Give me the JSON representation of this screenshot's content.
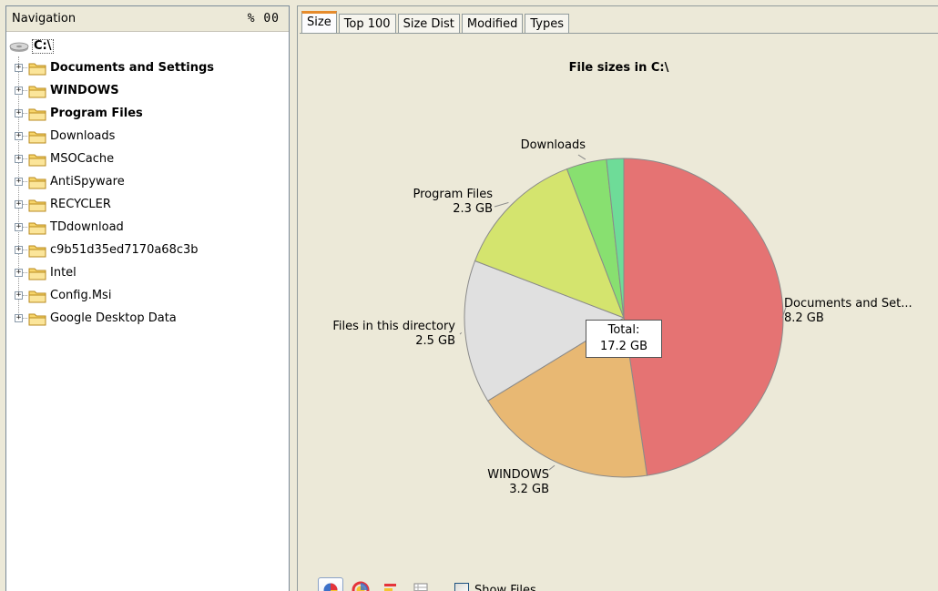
{
  "navigation": {
    "title": "Navigation",
    "controls": "% 00",
    "root": {
      "label": "C:\\",
      "icon": "hard-drive-icon"
    },
    "items": [
      {
        "label": "Documents and Settings",
        "bold": true
      },
      {
        "label": "WINDOWS",
        "bold": true
      },
      {
        "label": "Program Files",
        "bold": true
      },
      {
        "label": "Downloads",
        "bold": false
      },
      {
        "label": "MSOCache",
        "bold": false
      },
      {
        "label": "AntiSpyware",
        "bold": false
      },
      {
        "label": "RECYCLER",
        "bold": false
      },
      {
        "label": "TDdownload",
        "bold": false
      },
      {
        "label": "c9b51d35ed7170a68c3b",
        "bold": false
      },
      {
        "label": "Intel",
        "bold": false
      },
      {
        "label": "Config.Msi",
        "bold": false
      },
      {
        "label": "Google Desktop Data",
        "bold": false
      }
    ],
    "expander_glyph": "+"
  },
  "tabs": [
    {
      "label": "Size",
      "active": true
    },
    {
      "label": "Top 100",
      "active": false
    },
    {
      "label": "Size Dist",
      "active": false
    },
    {
      "label": "Modified",
      "active": false
    },
    {
      "label": "Types",
      "active": false
    }
  ],
  "chart_data": {
    "type": "pie",
    "title": "File sizes in C:\\",
    "total_label": "Total:",
    "total_value": "17.2 GB",
    "slices": [
      {
        "name": "Documents and Set...",
        "value_label": "8.2 GB",
        "value": 8.2,
        "color": "#e57373"
      },
      {
        "name": "WINDOWS",
        "value_label": "3.2 GB",
        "value": 3.2,
        "color": "#e8b873"
      },
      {
        "name": "Files in this directory",
        "value_label": "2.5 GB",
        "value": 2.5,
        "color": "#e0e0e0"
      },
      {
        "name": "Program Files",
        "value_label": "2.3 GB",
        "value": 2.3,
        "color": "#d4e46e"
      },
      {
        "name": "Downloads",
        "value_label": "",
        "value": 0.7,
        "color": "#88e070"
      },
      {
        "name": "",
        "value_label": "",
        "value": 0.3,
        "color": "#6edc98"
      }
    ]
  },
  "toolbar": {
    "buttons": [
      {
        "icon": "pie-chart-icon",
        "active": true
      },
      {
        "icon": "ring-chart-icon",
        "active": false
      },
      {
        "icon": "bar-chart-icon",
        "active": false
      },
      {
        "icon": "table-view-icon",
        "active": false
      }
    ],
    "show_files_label": "Show Files",
    "show_files_checked": false
  }
}
